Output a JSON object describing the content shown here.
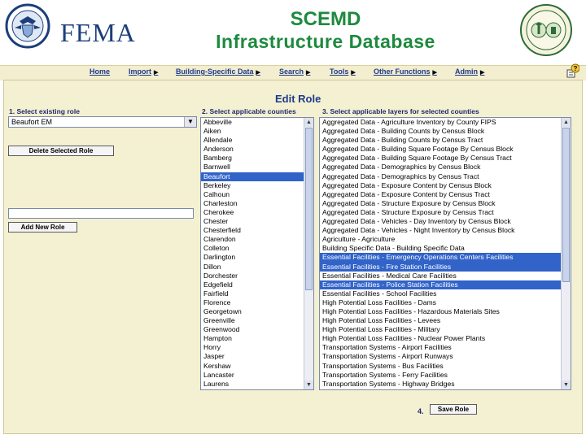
{
  "header": {
    "agency_name": "FEMA",
    "title_line1": "SCEMD",
    "title_line2": "Infrastructure Database"
  },
  "nav": {
    "items": [
      {
        "label": "Home",
        "has_arrow": false
      },
      {
        "label": "Import",
        "has_arrow": true
      },
      {
        "label": "Building-Specific Data",
        "has_arrow": true
      },
      {
        "label": "Search",
        "has_arrow": true
      },
      {
        "label": "Tools",
        "has_arrow": true
      },
      {
        "label": "Other Functions",
        "has_arrow": true
      },
      {
        "label": "Admin",
        "has_arrow": true
      }
    ]
  },
  "page": {
    "heading": "Edit Role",
    "step1_label": "1. Select existing role",
    "step2_label": "2. Select applicable counties",
    "step3_label": "3. Select applicable layers for selected counties",
    "step4_label": "4.",
    "role_select_value": "Beaufort EM",
    "delete_button": "Delete Selected Role",
    "new_role_value": "",
    "add_button": "Add New Role",
    "save_button": "Save Role"
  },
  "counties": {
    "items": [
      "Abbeville",
      "Aiken",
      "Allendale",
      "Anderson",
      "Bamberg",
      "Barnwell",
      "Beaufort",
      "Berkeley",
      "Calhoun",
      "Charleston",
      "Cherokee",
      "Chester",
      "Chesterfield",
      "Clarendon",
      "Colleton",
      "Darlington",
      "Dillon",
      "Dorchester",
      "Edgefield",
      "Fairfield",
      "Florence",
      "Georgetown",
      "Greenville",
      "Greenwood",
      "Hampton",
      "Horry",
      "Jasper",
      "Kershaw",
      "Lancaster",
      "Laurens"
    ],
    "selected": [
      "Beaufort"
    ]
  },
  "layers": {
    "items": [
      "Aggregated Data - Agriculture Inventory by County FIPS",
      "Aggregated Data - Building Counts by Census Block",
      "Aggregated Data - Building Counts by Census Tract",
      "Aggregated Data - Building Square Footage By Census Block",
      "Aggregated Data - Building Square Footage By Census Tract",
      "Aggregated Data - Demographics by Census Block",
      "Aggregated Data - Demographics by Census Tract",
      "Aggregated Data - Exposure Content by Census Block",
      "Aggregated Data - Exposure Content by Census Tract",
      "Aggregated Data - Structure Exposure by Census Block",
      "Aggregated Data - Structure Exposure by Census Tract",
      "Aggregated Data - Vehicles - Day Inventory by Census Block",
      "Aggregated Data - Vehicles - Night Inventory by Census Block",
      "Agriculture - Agriculture",
      "Building Specific Data - Building Specific Data",
      "Essential Facilities - Emergency Operations Centers Facilities",
      "Essential Facilities - Fire Station Facilities",
      "Essential Facilities - Medical Care Facilities",
      "Essential Facilities - Police Station Facilities",
      "Essential Facilities - School Facilities",
      "High Potential Loss Facilities - Dams",
      "High Potential Loss Facilities - Hazardous Materials Sites",
      "High Potential Loss Facilities - Levees",
      "High Potential Loss Facilities - Military",
      "High Potential Loss Facilities - Nuclear Power Plants",
      "Transportation Systems - Airport Facilities",
      "Transportation Systems - Airport Runways",
      "Transportation Systems - Bus Facilities",
      "Transportation Systems - Ferry Facilities",
      "Transportation Systems - Highway Bridges"
    ],
    "selected": [
      "Essential Facilities - Emergency Operations Centers Facilities",
      "Essential Facilities - Fire Station Facilities",
      "Essential Facilities - Police Station Facilities"
    ]
  },
  "colors": {
    "title_green": "#1d8a3e",
    "fema_blue": "#1c3f7a",
    "nav_link": "#1e3b8a",
    "panel_bg": "#f4f0d2",
    "selection": "#3163c8"
  }
}
